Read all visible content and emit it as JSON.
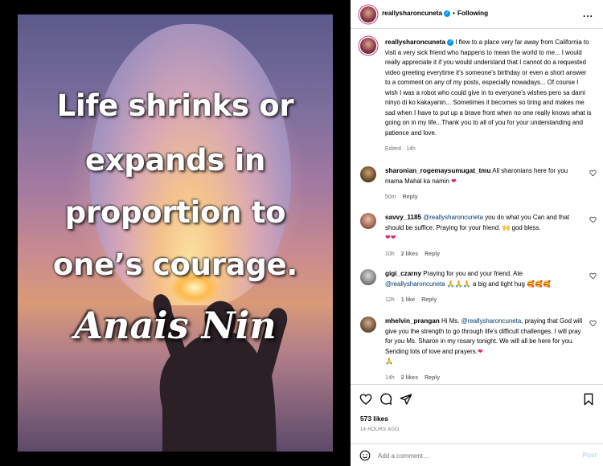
{
  "image": {
    "quote_lines": [
      "Life shrinks or",
      "expands in",
      "proportion to",
      "one’s courage."
    ],
    "author": "Anais Nin"
  },
  "header": {
    "username": "reallysharoncuneta",
    "separator": "•",
    "follow_label": "Following",
    "more_label": "..."
  },
  "caption": {
    "username": "reallysharoncuneta",
    "text": "I flew to a place very far away from California to visit a very sick friend who happens to mean the world to me... I would really appreciate it if you would understand that I cannot do a requested video greeting everytime it's someone's birthday or even a short answer to a comment on any of my posts, especially nowadays... Of course I wish I was a robot who could give in to everyone's wishes pero sa dami ninyo di ko kakayanin... Sometimes it becomes so tiring and makes me sad when I have to put up a brave front when no one really knows what is going on in my life...Thank you to all of you for your understanding and patience and love.",
    "edited": "Edited · 14h"
  },
  "comments": [
    {
      "username": "sharonian_rogemaysumugat_tmu",
      "text": "All sharonians here for you mama Mahal ka namin",
      "emoji": "❤",
      "time": "50m",
      "likes": "",
      "reply_label": "Reply"
    },
    {
      "username": "savvy_1185",
      "mention": "@reallysharoncuneta",
      "text": "you do what you Can and that should be suffice. Praying for your friend.",
      "emoji_mid": "🙌",
      "text2": "god bless.",
      "emoji": "❤❤",
      "time": "10h",
      "likes": "2 likes",
      "reply_label": "Reply"
    },
    {
      "username": "gigi_czarny",
      "text": "Praying for you and your friend. Ate",
      "mention": "@reallysharoncuneta",
      "emoji_mid": "🙏🙏🙏",
      "text2": "a big and tight hug",
      "emoji": "🥰🥰🥰",
      "time": "12h",
      "likes": "1 like",
      "reply_label": "Reply"
    },
    {
      "username": "mhelvin_prangan",
      "text": "Hi Ms.",
      "mention": "@reallysharoncuneta",
      "text2": ", praying that God will give you the strength to go through life's difficult challenges. I will pray for you Ms. Sharon in my rosary tonight. We will all be here for you. Sending lots of love and prayers.",
      "emoji": "❤",
      "emoji2": "🙏",
      "time": "14h",
      "likes": "2 likes",
      "reply_label": "Reply"
    }
  ],
  "actions": {
    "likes": "573 likes",
    "time_ago": "14 HOURS AGO",
    "comment_placeholder": "Add a comment…",
    "post_label": "Post"
  },
  "icons": {
    "like": "heart-icon",
    "comment": "comment-bubble-icon",
    "share": "share-plane-icon",
    "save": "bookmark-icon",
    "emoji": "smiley-icon",
    "verified": "verified-badge-icon"
  },
  "colors": {
    "link": "#00376b",
    "verified": "#0095f6",
    "muted": "#737373",
    "post_button": "#b3dbff",
    "heart": "#e0245e"
  }
}
